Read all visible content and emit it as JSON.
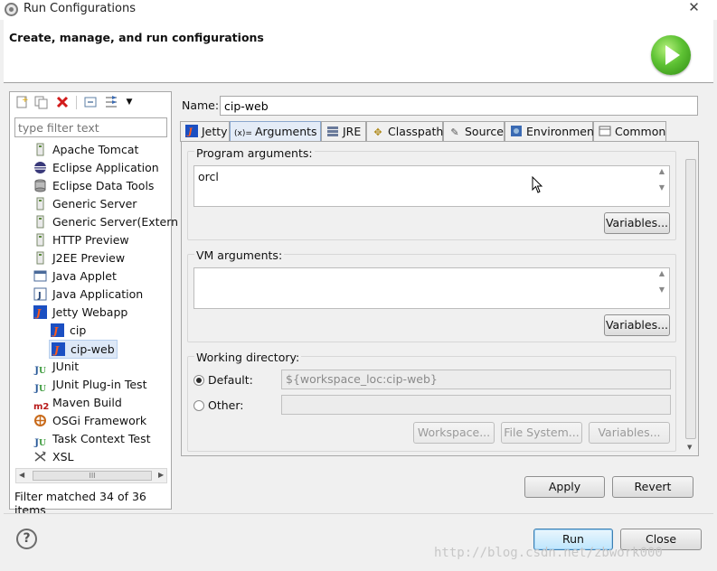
{
  "window": {
    "title": "Run Configurations",
    "close_glyph": "✕"
  },
  "header": {
    "title": "Create, manage, and run configurations"
  },
  "left": {
    "toolbar": [
      "new-config-icon",
      "duplicate-icon",
      "delete-icon",
      "collapse-all-icon",
      "filter-icon",
      "chevron-down-icon"
    ],
    "filter_placeholder": "type filter text",
    "tree": [
      {
        "label": "Apache Tomcat",
        "icon": "tomcat-icon",
        "indent": 0
      },
      {
        "label": "Eclipse Application",
        "icon": "eclipse-icon",
        "indent": 0
      },
      {
        "label": "Eclipse Data Tools",
        "icon": "database-icon",
        "indent": 0
      },
      {
        "label": "Generic Server",
        "icon": "server-icon",
        "indent": 0
      },
      {
        "label": "Generic Server(Extern",
        "icon": "server-icon",
        "indent": 0
      },
      {
        "label": "HTTP Preview",
        "icon": "server-icon",
        "indent": 0
      },
      {
        "label": "J2EE Preview",
        "icon": "server-icon",
        "indent": 0
      },
      {
        "label": "Java Applet",
        "icon": "java-applet-icon",
        "indent": 0
      },
      {
        "label": "Java Application",
        "icon": "java-app-icon",
        "indent": 0
      },
      {
        "label": "Jetty Webapp",
        "icon": "jetty-icon",
        "indent": 0
      },
      {
        "label": "cip",
        "icon": "jetty-icon",
        "indent": 1
      },
      {
        "label": "cip-web",
        "icon": "jetty-icon",
        "indent": 1,
        "selected": true
      },
      {
        "label": "JUnit",
        "icon": "junit-icon",
        "indent": 0
      },
      {
        "label": "JUnit Plug-in Test",
        "icon": "junit-plugin-icon",
        "indent": 0
      },
      {
        "label": "Maven Build",
        "icon": "maven-icon",
        "indent": 0
      },
      {
        "label": "OSGi Framework",
        "icon": "osgi-icon",
        "indent": 0
      },
      {
        "label": "Task Context Test",
        "icon": "task-test-icon",
        "indent": 0
      },
      {
        "label": "XSL",
        "icon": "xsl-icon",
        "indent": 0
      }
    ],
    "scroll_thumb": "III",
    "matched_text": "Filter matched 34 of 36 items"
  },
  "right": {
    "name_label": "Name:",
    "name_value": "cip-web",
    "tabs": [
      {
        "label": "Jetty",
        "icon": "jetty-icon"
      },
      {
        "label": "Arguments",
        "icon": "arguments-icon",
        "active": true
      },
      {
        "label": "JRE",
        "icon": "jre-icon"
      },
      {
        "label": "Classpath",
        "icon": "classpath-icon"
      },
      {
        "label": "Source",
        "icon": "source-icon"
      },
      {
        "label": "Environment",
        "icon": "environment-icon"
      },
      {
        "label": "Common",
        "icon": "common-icon"
      }
    ],
    "program_args": {
      "label": "Program arguments:",
      "value": "orcl",
      "variables_button": "Variables..."
    },
    "vm_args": {
      "label": "VM arguments:",
      "value": "",
      "variables_button": "Variables..."
    },
    "working_dir": {
      "label": "Working directory:",
      "default_label": "Default:",
      "default_value": "${workspace_loc:cip-web}",
      "other_label": "Other:",
      "other_value": "",
      "buttons": [
        "Workspace...",
        "File System...",
        "Variables..."
      ]
    },
    "apply_button": "Apply",
    "revert_button": "Revert"
  },
  "footer": {
    "run_button": "Run",
    "close_button": "Close",
    "help_glyph": "?",
    "watermark": "http://blog.csdn.net/zbwork000"
  },
  "colors": {
    "accent": "#3c7fb1",
    "selection": "#dde8f7",
    "jetty": "#1b4fc2",
    "delete": "#d21b1b",
    "run": "#5ec234"
  }
}
